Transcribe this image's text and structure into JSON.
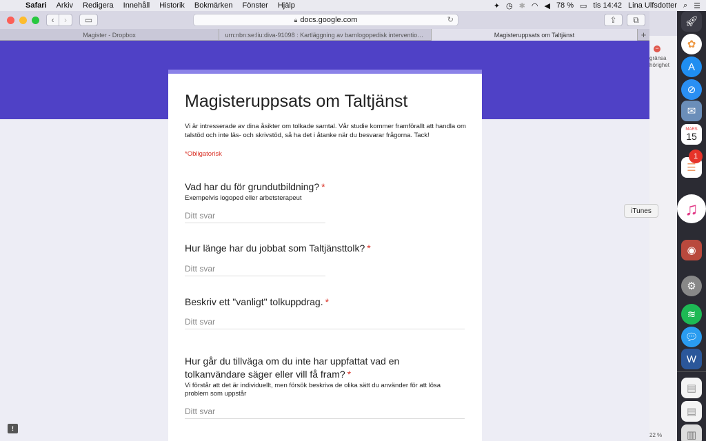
{
  "menubar": {
    "items": [
      "Safari",
      "Arkiv",
      "Redigera",
      "Innehåll",
      "Historik",
      "Bokmärken",
      "Fönster",
      "Hjälp"
    ],
    "battery": "78 %",
    "clock": "tis 14:42",
    "user": "Lina Ulfsdotter"
  },
  "browser": {
    "url": "docs.google.com",
    "tabs": [
      {
        "label": "Magister - Dropbox"
      },
      {
        "label": "urn:nbn:se:liu:diva-91098 : Kartläggning av barnlogopedisk intervention i..."
      },
      {
        "label": "Magisteruppsats om Taltjänst"
      }
    ]
  },
  "form": {
    "title": "Magisteruppsats om Taltjänst",
    "description": "Vi är intresserade av dina åsikter om tolkade samtal. Vår studie kommer framförallt att handla om talstöd och inte läs- och skrivstöd, så ha det i åtanke när du besvarar frågorna. Tack!",
    "required_note": "*Obligatorisk",
    "required_mark": "*",
    "questions": [
      {
        "title": "Vad har du för grundutbildning?",
        "help": "Exempelvis logoped eller arbetsterapeut",
        "placeholder": "Ditt svar"
      },
      {
        "title": "Hur länge har du jobbat som Taltjänsttolk?",
        "placeholder": "Ditt svar"
      },
      {
        "title": "Beskriv ett \"vanligt\" tolkuppdrag.",
        "placeholder": "Ditt svar"
      },
      {
        "title": "Hur går du tillväga om du inte har uppfattat vad en tolkanvändare säger eller vill få fram?",
        "help": "Vi förstår att det är individuellt, men försök beskriva de olika sätt du använder för att lösa problem som uppstår",
        "placeholder": "Ditt svar"
      }
    ]
  },
  "background_window": {
    "text": "gränsa\nhörighet",
    "zoom": "22 %"
  },
  "dock": {
    "tooltip": "iTunes",
    "calendar_month": "MARS",
    "calendar_day": "15",
    "reminders_badge": "1"
  },
  "colors": {
    "banner": "#4f41c6",
    "accent": "#8b82e8",
    "required": "#d93025"
  }
}
